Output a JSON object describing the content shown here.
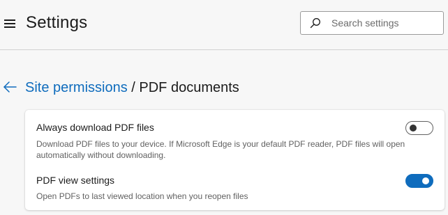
{
  "header": {
    "title": "Settings",
    "search": {
      "placeholder": "Search settings",
      "value": ""
    }
  },
  "breadcrumb": {
    "parent": "Site permissions",
    "separator": " / ",
    "current": "PDF documents"
  },
  "settings": [
    {
      "title": "Always download PDF files",
      "description": "Download PDF files to your device. If Microsoft Edge is your default PDF reader, PDF files will open automatically without downloading.",
      "enabled": false
    },
    {
      "title": "PDF view settings",
      "description": "Open PDFs to last viewed location when you reopen files",
      "enabled": true
    }
  ],
  "colors": {
    "accent": "#0f6cbd",
    "background": "#f7f7f7",
    "card": "#ffffff"
  },
  "icons": {
    "menu": "hamburger-icon",
    "search": "search-icon",
    "back": "back-arrow-icon"
  }
}
